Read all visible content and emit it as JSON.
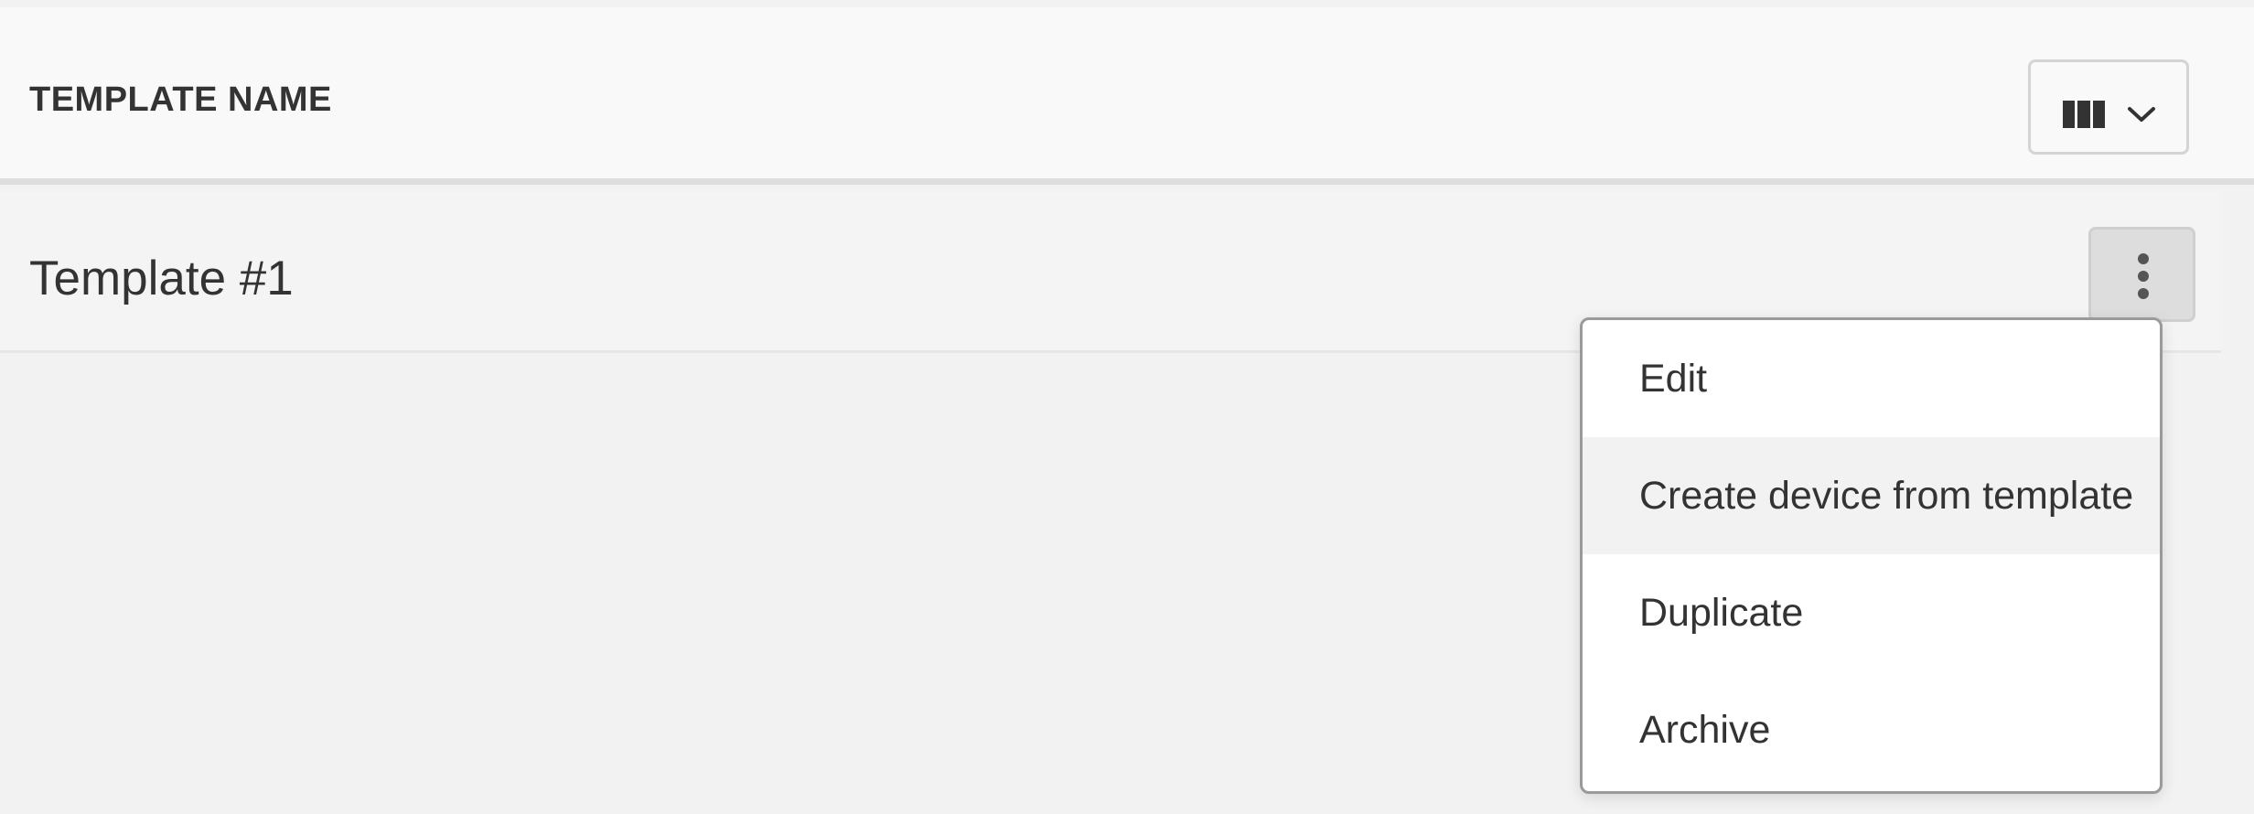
{
  "table": {
    "header": {
      "column_label": "TEMPLATE NAME",
      "columns_button_icon": "columns-icon",
      "dropdown_icon": "chevron-down-icon"
    },
    "rows": [
      {
        "name": "Template #1",
        "actions_icon": "kebab-vertical-icon"
      }
    ]
  },
  "row_menu": {
    "items": [
      {
        "label": "Edit"
      },
      {
        "label": "Create device from template",
        "highlighted": true
      },
      {
        "label": "Duplicate"
      },
      {
        "label": "Archive"
      }
    ]
  },
  "colors": {
    "page_background": "#f2f2f2",
    "header_background": "#f9f9fa",
    "row_background": "#f4f4f4",
    "menu_background": "#ffffff",
    "menu_hover": "#f2f2f2",
    "text": "#333333"
  }
}
